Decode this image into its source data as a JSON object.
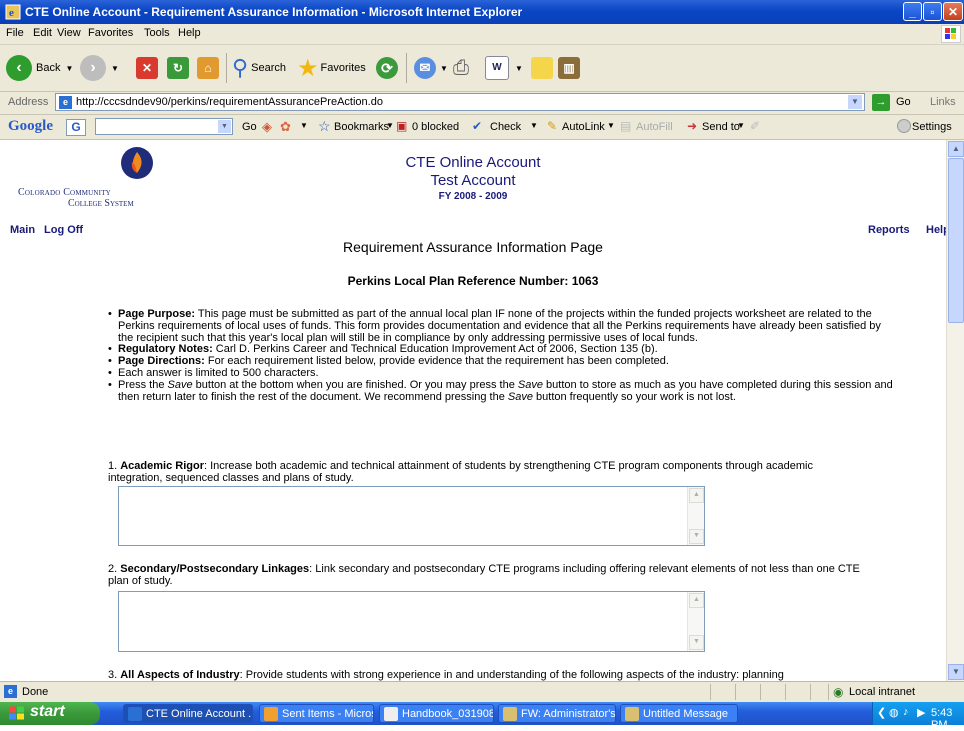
{
  "window": {
    "title": "CTE Online Account - Requirement Assurance Information - Microsoft Internet Explorer"
  },
  "menu": [
    "File",
    "Edit",
    "View",
    "Favorites",
    "Tools",
    "Help"
  ],
  "toolbar": {
    "back": "Back",
    "search": "Search",
    "favorites": "Favorites"
  },
  "address": {
    "label": "Address",
    "url": "http://cccsdndev90/perkins/requirementAssurancePreAction.do",
    "go": "Go",
    "links": "Links"
  },
  "google": {
    "logo": "Google",
    "go": "Go",
    "bookmarks": "Bookmarks",
    "blocked": "0 blocked",
    "check": "Check",
    "autolink": "AutoLink",
    "autofill": "AutoFill",
    "sendto": "Send to",
    "settings": "Settings"
  },
  "header": {
    "logo_line1": "Colorado Community",
    "logo_line2": "College System",
    "title1": "CTE Online Account",
    "title2": "Test Account",
    "fy": "FY 2008 - 2009"
  },
  "nav": {
    "main": "Main",
    "logoff": "Log Off",
    "reports": "Reports",
    "help": "Help"
  },
  "page": {
    "title": "Requirement Assurance Information Page",
    "ref_label": "Perkins Local Plan Reference Number: 1063"
  },
  "bullets": [
    {
      "label": "Page Purpose:",
      "text": " This page must be submitted as part of the annual local plan IF none of the projects within the funded projects worksheet are related to the Perkins requirements of local uses of funds. This form provides documentation and evidence that all the Perkins requirements have already been satisfied by the recipient such that this year's local plan will still be in compliance by only addressing permissive uses of local funds."
    },
    {
      "label": "Regulatory Notes:",
      "text": " Carl D. Perkins Career and Technical Education Improvement Act of 2006, Section 135 (b)."
    },
    {
      "label": "Page Directions:",
      "text": " For each requirement listed below, provide evidence that the requirement has been completed."
    },
    {
      "label": "",
      "text": "Each answer is limited to 500 characters."
    }
  ],
  "bullet5": {
    "a": "Press the ",
    "save1": "Save",
    "b": " button at the bottom when you are finished. Or you may press the ",
    "save2": "Save",
    "c": " button to store as much as you have completed during this session and then return later to finish the rest of the document. We recommend pressing the ",
    "save3": "Save",
    "d": " button frequently so your work is not lost."
  },
  "questions": [
    {
      "num": "1. ",
      "label": "Academic Rigor",
      "text": ": Increase both academic and technical attainment of students by strengthening CTE program components through academic integration, sequenced classes and plans of study.",
      "value": ""
    },
    {
      "num": "2. ",
      "label": "Secondary/Postsecondary Linkages",
      "text": ": Link secondary and postsecondary CTE programs including offering relevant elements of not less than one CTE plan of study.",
      "value": ""
    },
    {
      "num": "3. ",
      "label": "All Aspects of Industry",
      "text": ": Provide students with strong experience in and understanding of the following aspects of the industry: planning"
    }
  ],
  "status": {
    "done": "Done",
    "zone": "Local intranet"
  },
  "taskbar": {
    "start": "start",
    "items": [
      "CTE Online Account ...",
      "Sent Items - Microso...",
      "Handbook_031908_...",
      "FW: Administrator's ...",
      "Untitled Message"
    ],
    "clock": "5:43 PM"
  }
}
